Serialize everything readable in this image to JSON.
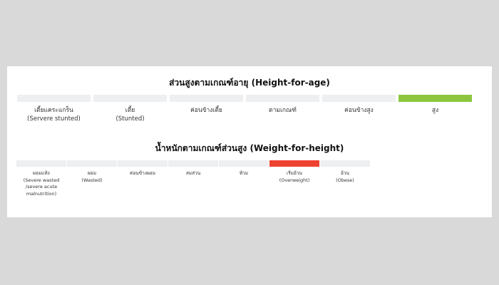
{
  "colors": {
    "background": "#d9d9d9",
    "panel": "#ffffff",
    "inactive_bar": "#eeeff1",
    "height_highlight": "#8cc63f",
    "weight_highlight": "#ee4330"
  },
  "height_for_age": {
    "title": "ส่วนสูงตามเกณฑ์อายุ (Height-for-age)",
    "categories": [
      {
        "label": "เตี้ยแคระแกร็น",
        "sub": "(Servere stunted)",
        "highlight": false
      },
      {
        "label": "เตี้ย",
        "sub": "(Stunted)",
        "highlight": false
      },
      {
        "label": "ค่อนข้างเตี้ย",
        "sub": "",
        "highlight": false
      },
      {
        "label": "ตามเกณฑ์",
        "sub": "",
        "highlight": false
      },
      {
        "label": "ค่อนข้างสูง",
        "sub": "",
        "highlight": false
      },
      {
        "label": "สูง",
        "sub": "",
        "highlight": true
      }
    ]
  },
  "weight_for_height": {
    "title": "น้ำหนักตามเกณฑ์ส่วนสูง (Weight-for-height)",
    "categories": [
      {
        "label": "ผอมแห้ง",
        "sub": "(Severe wasted",
        "sub2": "/severe acute",
        "sub3": "malnutrition)",
        "highlight": false
      },
      {
        "label": "ผอม",
        "sub": "(Wasted)",
        "sub2": "",
        "sub3": "",
        "highlight": false
      },
      {
        "label": "ค่อนข้างผอม",
        "sub": "",
        "sub2": "",
        "sub3": "",
        "highlight": false
      },
      {
        "label": "สมส่วน",
        "sub": "",
        "sub2": "",
        "sub3": "",
        "highlight": false
      },
      {
        "label": "ท้วม",
        "sub": "",
        "sub2": "",
        "sub3": "",
        "highlight": false
      },
      {
        "label": "เริ่มอ้วน",
        "sub": "(Overweight)",
        "sub2": "",
        "sub3": "",
        "highlight": true
      },
      {
        "label": "อ้วน",
        "sub": "(Obese)",
        "sub2": "",
        "sub3": "",
        "highlight": false
      }
    ]
  }
}
